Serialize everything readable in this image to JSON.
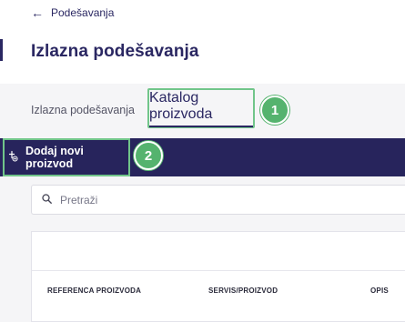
{
  "header": {
    "back_label": "Podešavanja",
    "title": "Izlazna podešavanja"
  },
  "tabs": [
    {
      "label": "Izlazna podešavanja",
      "active": false
    },
    {
      "label": "Katalog proizvoda",
      "active": true
    }
  ],
  "callouts": [
    "1",
    "2"
  ],
  "action_bar": {
    "add_label": "Dodaj novi proizvod"
  },
  "search": {
    "placeholder": "Pretraži"
  },
  "table": {
    "columns": [
      "REFERENCA PROIZVODA",
      "SERVIS/PROIZVOD",
      "OPIS"
    ]
  },
  "colors": {
    "brand": "#27245c",
    "highlight": "#71c58a",
    "callout": "#55b36e"
  }
}
